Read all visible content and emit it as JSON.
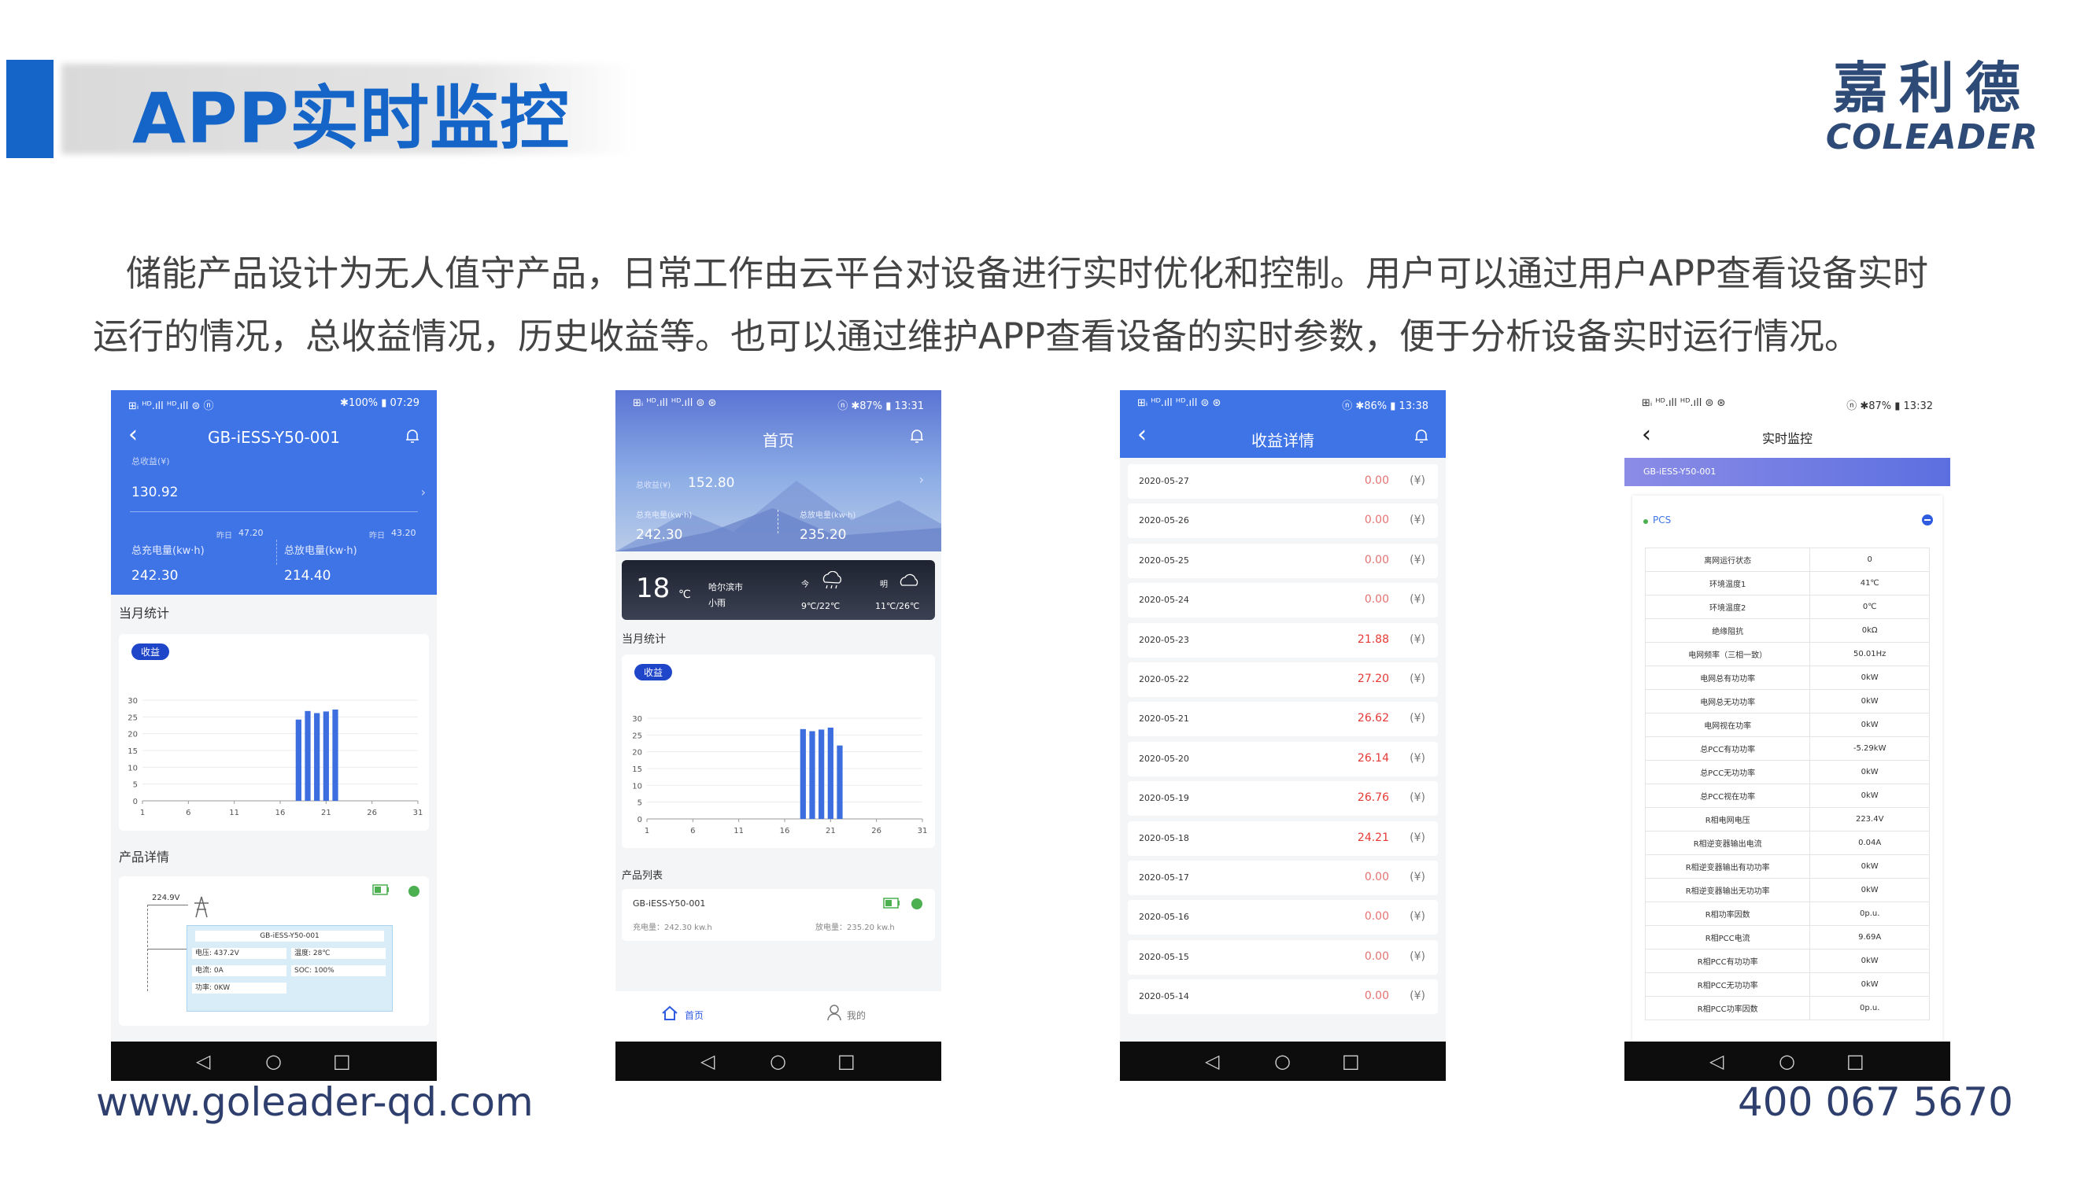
{
  "header": {
    "title": "APP实时监控",
    "logo_cn": "嘉利德",
    "logo_en": "COLEADER"
  },
  "intro": {
    "line1": "储能产品设计为无人值守产品，日常工作由云平台对设备进行实时优化和控制。用户可以通过用户APP查看设备实时",
    "line2": "运行的情况，总收益情况，历史收益等。也可以通过维护APP查看设备的实时参数，便于分析设备实时运行情况。"
  },
  "footer": {
    "url": "www.goleader-qd.com",
    "phone": "400 067 5670"
  },
  "colors": {
    "brand_blue": "#1565c8",
    "app_blue": "#3f74e6",
    "bar_blue": "#3d6ee0",
    "income_red": "#e53935"
  },
  "nav_keys": {
    "back": "◁",
    "home": "○",
    "recent": "□"
  },
  "phone1": {
    "status_left": "⊞ᵢ ᴴᴰ.ıll ᴴᴰ.ıll ⊜ ⓝ",
    "status_right": "✱100% ▮ 07:29",
    "title": "GB-iESS-Y50-001",
    "total_income_label": "总收益(¥)",
    "total_income": "130.92",
    "yesterday1_label": "昨日",
    "yesterday1": "47.20",
    "yesterday2_label": "昨日",
    "yesterday2": "43.20",
    "charge_label": "总充电量(kw·h)",
    "charge": "242.30",
    "discharge_label": "总放电量(kw·h)",
    "discharge": "214.40",
    "month_title": "当月统计",
    "pill": "收益",
    "product_title": "产品详情",
    "diagram": {
      "voltage": "224.9V",
      "device": "GB-iESS-Y50-001",
      "fields": [
        "电压: 437.2V",
        "温度: 28℃",
        "电流: 0A",
        "SOC: 100%",
        "功率: 0KW"
      ]
    }
  },
  "phone2": {
    "status_left": "⊞ᵢ ᴴᴰ.ıll ᴴᴰ.ıll ⊜ ⊛",
    "status_right": "ⓝ ✱87% ▮ 13:31",
    "title": "首页",
    "total_income_label": "总收益(¥)",
    "total_income": "152.80",
    "charge_label": "总充电量(kw·h)",
    "charge": "242.30",
    "discharge_label": "总放电量(kw·h)",
    "discharge": "235.20",
    "weather": {
      "temp": "18",
      "unit": "℃",
      "city": "哈尔滨市",
      "cond": "小雨",
      "today_label": "今",
      "today": "9℃/22℃",
      "tomorrow_label": "明",
      "tomorrow": "11℃/26℃"
    },
    "month_title": "当月统计",
    "pill": "收益",
    "list_title": "产品列表",
    "device": "GB-iESS-Y50-001",
    "charge_item": "充电量：242.30 kw.h",
    "discharge_item": "放电量：235.20 kw.h",
    "tab_home": "首页",
    "tab_mine": "我的"
  },
  "phone3": {
    "status_left": "⊞ᵢ ᴴᴰ.ıll ᴴᴰ.ıll ⊜ ⊛",
    "status_right": "ⓝ ✱86% ▮ 13:38",
    "title": "收益详情",
    "currency": "(¥)",
    "rows": [
      {
        "date": "2020-05-27",
        "value": "0.00"
      },
      {
        "date": "2020-05-26",
        "value": "0.00"
      },
      {
        "date": "2020-05-25",
        "value": "0.00"
      },
      {
        "date": "2020-05-24",
        "value": "0.00"
      },
      {
        "date": "2020-05-23",
        "value": "21.88"
      },
      {
        "date": "2020-05-22",
        "value": "27.20"
      },
      {
        "date": "2020-05-21",
        "value": "26.62"
      },
      {
        "date": "2020-05-20",
        "value": "26.14"
      },
      {
        "date": "2020-05-19",
        "value": "26.76"
      },
      {
        "date": "2020-05-18",
        "value": "24.21"
      },
      {
        "date": "2020-05-17",
        "value": "0.00"
      },
      {
        "date": "2020-05-16",
        "value": "0.00"
      },
      {
        "date": "2020-05-15",
        "value": "0.00"
      },
      {
        "date": "2020-05-14",
        "value": "0.00"
      }
    ]
  },
  "phone4": {
    "status_left": "⊞ᵢ ᴴᴰ.ıll ᴴᴰ.ıll ⊜ ⊛",
    "status_right": "ⓝ ✱87% ▮ 13:32",
    "title": "实时监控",
    "device_bar": "GB-iESS-Y50-001",
    "section": "PCS",
    "params": [
      [
        "离网运行状态",
        "0"
      ],
      [
        "环境温度1",
        "41℃"
      ],
      [
        "环境温度2",
        "0℃"
      ],
      [
        "绝缘阻抗",
        "0kΩ"
      ],
      [
        "电网频率（三相一致）",
        "50.01Hz"
      ],
      [
        "电网总有功功率",
        "0kW"
      ],
      [
        "电网总无功功率",
        "0kW"
      ],
      [
        "电网视在功率",
        "0kW"
      ],
      [
        "总PCC有功功率",
        "-5.29kW"
      ],
      [
        "总PCC无功功率",
        "0kW"
      ],
      [
        "总PCC视在功率",
        "0kW"
      ],
      [
        "R相电网电压",
        "223.4V"
      ],
      [
        "R相逆变器输出电流",
        "0.04A"
      ],
      [
        "R相逆变器输出有功功率",
        "0kW"
      ],
      [
        "R相逆变器输出无功功率",
        "0kW"
      ],
      [
        "R相功率因数",
        "0p.u."
      ],
      [
        "R相PCC电流",
        "9.69A"
      ],
      [
        "R相PCC有功功率",
        "0kW"
      ],
      [
        "R相PCC无功功率",
        "0kW"
      ],
      [
        "R相PCC功率因数",
        "0p.u."
      ]
    ]
  },
  "chart_data": [
    {
      "type": "bar",
      "x": [
        1,
        6,
        11,
        16,
        21,
        26,
        31
      ],
      "bars": [
        {
          "x": 18,
          "y": 24.21
        },
        {
          "x": 19,
          "y": 26.76
        },
        {
          "x": 20,
          "y": 26.14
        },
        {
          "x": 21,
          "y": 26.62
        },
        {
          "x": 22,
          "y": 27.2
        }
      ],
      "yticks": [
        0,
        5,
        10,
        15,
        20,
        25,
        30
      ],
      "ylim": [
        0,
        30
      ],
      "xlim": [
        1,
        31
      ]
    },
    {
      "type": "bar",
      "x": [
        1,
        6,
        11,
        16,
        21,
        26,
        31
      ],
      "bars": [
        {
          "x": 18,
          "y": 26.76
        },
        {
          "x": 19,
          "y": 26.14
        },
        {
          "x": 20,
          "y": 26.62
        },
        {
          "x": 21,
          "y": 27.2
        },
        {
          "x": 22,
          "y": 21.88
        }
      ],
      "yticks": [
        0,
        5,
        10,
        15,
        20,
        25,
        30
      ],
      "ylim": [
        0,
        30
      ],
      "xlim": [
        1,
        31
      ]
    }
  ]
}
